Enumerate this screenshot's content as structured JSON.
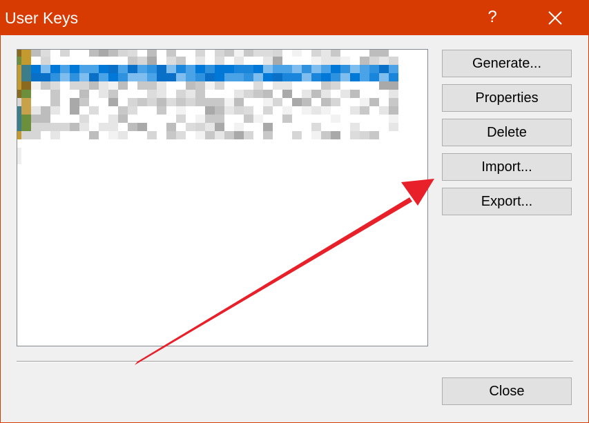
{
  "window": {
    "title": "User Keys",
    "help_label": "?",
    "accent_color": "#d83b01"
  },
  "buttons": {
    "generate": "Generate...",
    "properties": "Properties",
    "delete": "Delete",
    "import": "Import...",
    "export": "Export...",
    "close": "Close"
  },
  "key_list": {
    "state": "pixelated/obscured",
    "row_count_visible": 5,
    "selected_row": 1
  },
  "annotation": {
    "type": "arrow",
    "color": "#e8202a",
    "points_to": "import-button"
  }
}
